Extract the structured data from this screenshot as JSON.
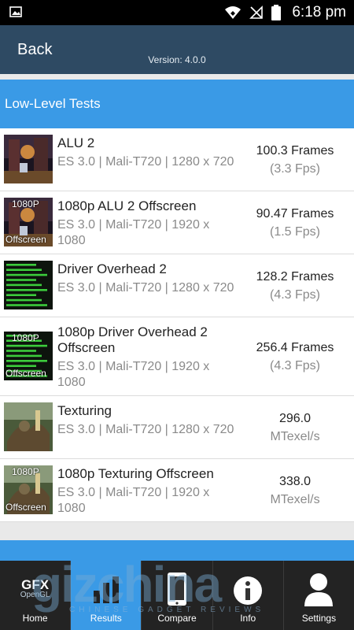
{
  "status_bar": {
    "time": "6:18 pm"
  },
  "header": {
    "back_label": "Back",
    "version": "Version: 4.0.0"
  },
  "section": {
    "title": "Low-Level Tests"
  },
  "tests": [
    {
      "title": "ALU 2",
      "subtitle": "ES 3.0 | Mali-T720 | 1280 x 720",
      "value": "100.3 Frames",
      "unit": "(3.3 Fps)",
      "thumb": "alu",
      "offscreen": false
    },
    {
      "title": "1080p ALU 2 Offscreen",
      "subtitle": "ES 3.0 | Mali-T720 | 1920 x 1080",
      "value": "90.47 Frames",
      "unit": "(1.5 Fps)",
      "thumb": "alu",
      "offscreen": true
    },
    {
      "title": "Driver Overhead 2",
      "subtitle": "ES 3.0 | Mali-T720 | 1280 x 720",
      "value": "128.2 Frames",
      "unit": "(4.3 Fps)",
      "thumb": "driver",
      "offscreen": false
    },
    {
      "title": "1080p Driver Overhead 2 Offscreen",
      "subtitle": "ES 3.0 | Mali-T720 | 1920 x 1080",
      "value": "256.4 Frames",
      "unit": "(4.3 Fps)",
      "thumb": "driver",
      "offscreen": true
    },
    {
      "title": "Texturing",
      "subtitle": "ES 3.0 | Mali-T720 | 1280 x 720",
      "value": "296.0",
      "unit": "MTexel/s",
      "thumb": "texture",
      "offscreen": false
    },
    {
      "title": "1080p Texturing Offscreen",
      "subtitle": "ES 3.0 | Mali-T720 | 1920 x 1080",
      "value": "338.0",
      "unit": "MTexel/s",
      "thumb": "texture",
      "offscreen": true
    }
  ],
  "thumb_tags": {
    "top": "1080P",
    "bottom": "Offscreen"
  },
  "nav": {
    "logo_line1": "GFX",
    "logo_line2": "OpenGL",
    "tabs": [
      {
        "label": "Home",
        "icon": "gfx-logo-icon",
        "active": false
      },
      {
        "label": "Results",
        "icon": "bar-chart-icon",
        "active": true
      },
      {
        "label": "Compare",
        "icon": "phone-icon",
        "active": false
      },
      {
        "label": "Info",
        "icon": "info-icon",
        "active": false
      },
      {
        "label": "Settings",
        "icon": "user-icon",
        "active": false
      }
    ]
  },
  "watermark": {
    "main": "gizchina",
    "sub": "CHINESE GADGET REVIEWS"
  },
  "colors": {
    "header": "#2e4a63",
    "accent": "#3a9ae6",
    "nav": "#232323"
  }
}
